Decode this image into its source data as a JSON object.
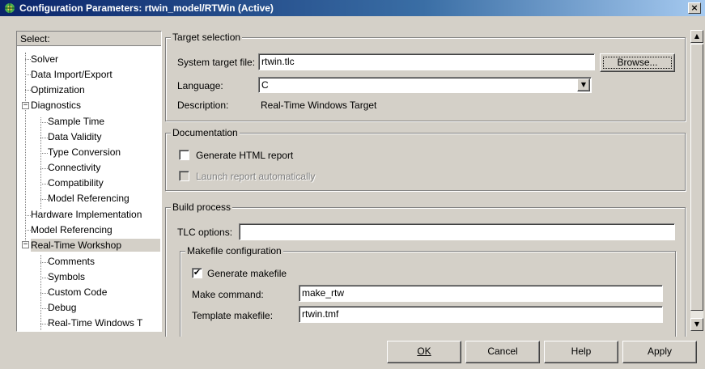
{
  "window": {
    "title": "Configuration Parameters: rtwin_model/RTWin (Active)",
    "close_label": "×"
  },
  "tree": {
    "header": "Select:",
    "items": [
      {
        "label": "Solver"
      },
      {
        "label": "Data Import/Export"
      },
      {
        "label": "Optimization"
      },
      {
        "label": "Diagnostics",
        "expanded": true
      },
      {
        "label": "Sample Time"
      },
      {
        "label": "Data Validity"
      },
      {
        "label": "Type Conversion"
      },
      {
        "label": "Connectivity"
      },
      {
        "label": "Compatibility"
      },
      {
        "label": "Model Referencing"
      },
      {
        "label": "Hardware Implementation"
      },
      {
        "label": "Model Referencing"
      },
      {
        "label": "Real-Time Workshop",
        "expanded": true,
        "selected": true
      },
      {
        "label": "Comments"
      },
      {
        "label": "Symbols"
      },
      {
        "label": "Custom Code"
      },
      {
        "label": "Debug"
      },
      {
        "label": "Real-Time Windows T"
      }
    ]
  },
  "target_selection": {
    "title": "Target selection",
    "system_target_label": "System target file:",
    "system_target_value": "rtwin.tlc",
    "browse_label": "Browse...",
    "language_label": "Language:",
    "language_value": "C",
    "description_label": "Description:",
    "description_value": "Real-Time Windows Target"
  },
  "documentation": {
    "title": "Documentation",
    "generate_html_label": "Generate HTML report",
    "launch_report_label": "Launch report automatically"
  },
  "build_process": {
    "title": "Build process",
    "tlc_options_label": "TLC options:",
    "tlc_options_value": "",
    "makefile_config": {
      "title": "Makefile configuration",
      "generate_makefile_label": "Generate makefile",
      "generate_makefile_checked": "✔",
      "make_command_label": "Make command:",
      "make_command_value": "make_rtw",
      "template_makefile_label": "Template makefile:",
      "template_makefile_value": "rtwin.tmf"
    }
  },
  "buttons": {
    "ok": "OK",
    "cancel": "Cancel",
    "help": "Help",
    "apply": "Apply"
  },
  "colors": {
    "title_bar": "#0a246a",
    "window_bg": "#d4d0c8"
  }
}
